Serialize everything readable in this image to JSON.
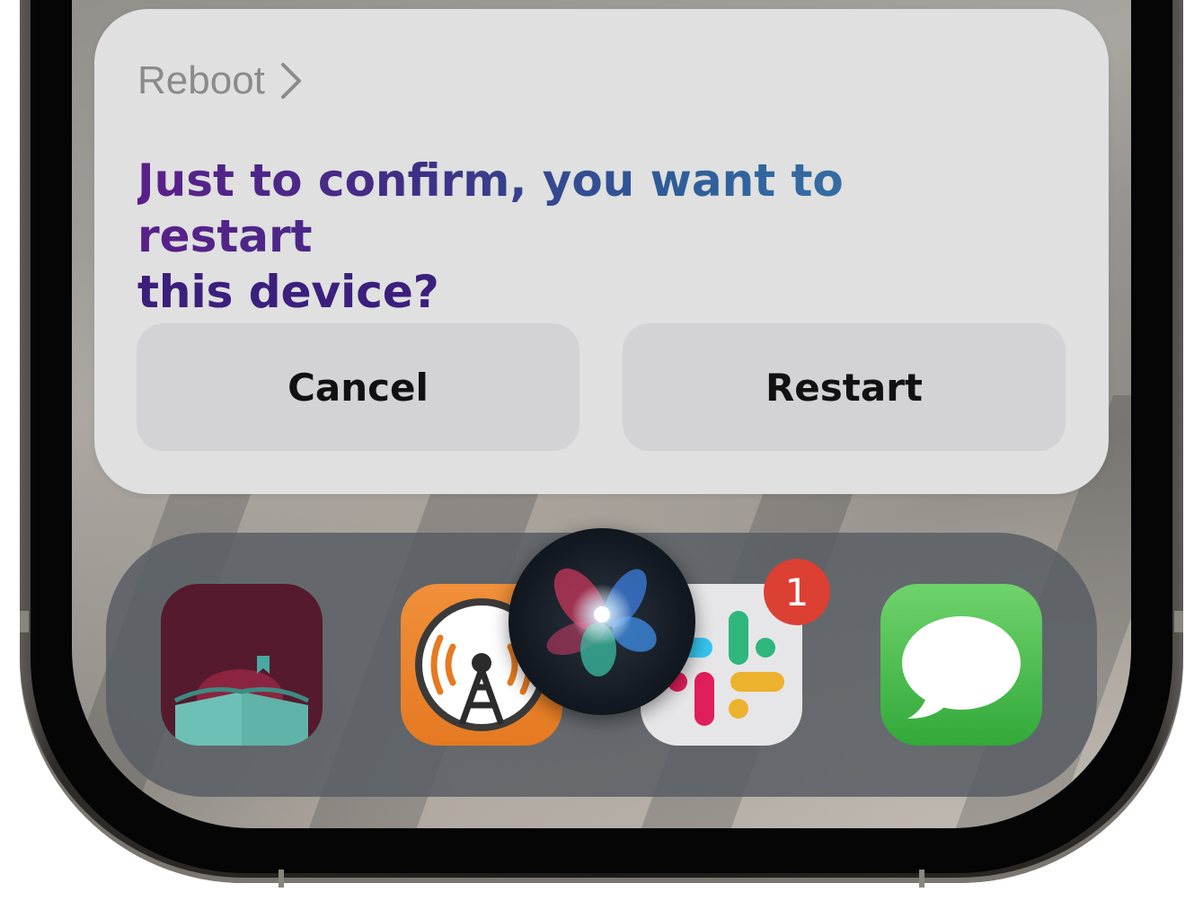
{
  "siri_card": {
    "shortcut_name": "Reboot",
    "question_line1": "Just to confirm, you want to restart",
    "question_line2": "this device?",
    "cancel_label": "Cancel",
    "confirm_label": "Restart"
  },
  "dock": {
    "apps": [
      {
        "name": "Libby",
        "icon": "libby-icon"
      },
      {
        "name": "Overcast",
        "icon": "overcast-icon"
      },
      {
        "name": "Slack",
        "icon": "slack-icon",
        "badge": "1"
      },
      {
        "name": "Messages",
        "icon": "messages-icon"
      }
    ]
  },
  "colors": {
    "card_background": "#dfe0df",
    "button_background": "#d3d3d5",
    "badge_red": "#dc4033",
    "messages_green": "#34c759"
  }
}
